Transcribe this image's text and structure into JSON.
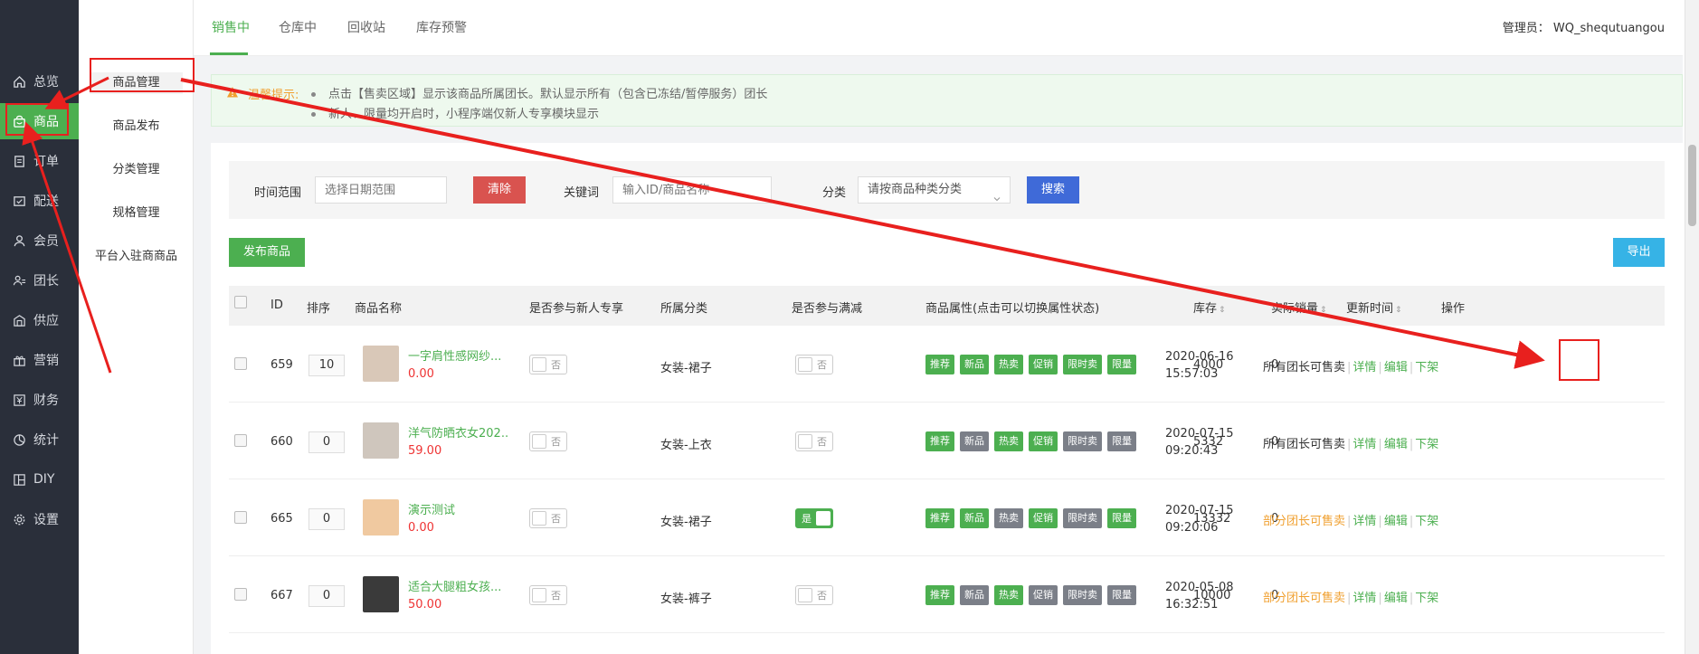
{
  "nav": {
    "items": [
      {
        "label": "总览",
        "icon": "home-icon"
      },
      {
        "label": "商品",
        "icon": "shop-bag-icon",
        "active": true
      },
      {
        "label": "订单",
        "icon": "order-icon"
      },
      {
        "label": "配送",
        "icon": "delivery-icon"
      },
      {
        "label": "会员",
        "icon": "user-icon"
      },
      {
        "label": "团长",
        "icon": "leader-icon"
      },
      {
        "label": "供应",
        "icon": "supply-icon"
      },
      {
        "label": "营销",
        "icon": "gift-icon"
      },
      {
        "label": "财务",
        "icon": "finance-icon"
      },
      {
        "label": "统计",
        "icon": "chart-icon"
      },
      {
        "label": "DIY",
        "icon": "diy-icon"
      },
      {
        "label": "设置",
        "icon": "settings-icon"
      }
    ]
  },
  "submenu": {
    "items": [
      "商品管理",
      "商品发布",
      "分类管理",
      "规格管理",
      "平台入驻商商品"
    ]
  },
  "tabs": [
    "销售中",
    "仓库中",
    "回收站",
    "库存预警"
  ],
  "admin": "管理员： WQ_shequtuangou",
  "tip": {
    "label": "温馨提示:",
    "lines": [
      "点击【售卖区域】显示该商品所属团长。默认显示所有（包含已冻结/暂停服务）团长",
      "新人、限量均开启时，小程序端仅新人专享模块显示"
    ]
  },
  "filter": {
    "time_label": "时间范围",
    "time_placeholder": "选择日期范围",
    "clear_label": "清除",
    "keyword_label": "关键词",
    "keyword_placeholder": "输入ID/商品名称",
    "category_label": "分类",
    "category_placeholder": "请按商品种类分类",
    "search_label": "搜索"
  },
  "actions": {
    "publish_label": "发布商品",
    "export_label": "导出"
  },
  "table": {
    "headers": {
      "id": "ID",
      "sort": "排序",
      "name": "商品名称",
      "newcomer": "是否参与新人专享",
      "category": "所属分类",
      "fullcut": "是否参与满减",
      "attrs": "商品属性(点击可以切换属性状态)",
      "stock": "库存",
      "sales": "实际销量",
      "updated": "更新时间",
      "ops": "操作"
    },
    "sort_marker": "⇕",
    "tag_names": [
      "推荐",
      "新品",
      "热卖",
      "促销",
      "限时卖",
      "限量"
    ],
    "rows": [
      {
        "id": "659",
        "sort": "10",
        "name": "一字肩性感网纱...",
        "price": "0.00",
        "thumb_color": "#d9c8b8",
        "newcomer": "否",
        "category": "女装-裙子",
        "fullcut": "否",
        "fullcut_on": false,
        "tags_on": [
          true,
          true,
          true,
          true,
          true,
          true
        ],
        "stock": "4000",
        "sales": "0",
        "date": "2020-06-16",
        "time": "15:57:03",
        "scope": "所有团长可售卖",
        "scope_partial": false,
        "op_detail": "详情",
        "op_edit": "编辑",
        "op_off": "下架"
      },
      {
        "id": "660",
        "sort": "0",
        "name": "洋气防晒衣女202...",
        "price": "59.00",
        "thumb_color": "#cfc6bd",
        "newcomer": "否",
        "category": "女装-上衣",
        "fullcut": "否",
        "fullcut_on": false,
        "tags_on": [
          true,
          false,
          true,
          true,
          false,
          false
        ],
        "stock": "5332",
        "sales": "0",
        "date": "2020-07-15",
        "time": "09:20:43",
        "scope": "所有团长可售卖",
        "scope_partial": false,
        "op_detail": "详情",
        "op_edit": "编辑",
        "op_off": "下架"
      },
      {
        "id": "665",
        "sort": "0",
        "name": "演示测试",
        "price": "0.00",
        "thumb_color": "#f0c9a0",
        "newcomer": "否",
        "category": "女装-裙子",
        "fullcut": "是",
        "fullcut_on": true,
        "tags_on": [
          true,
          true,
          false,
          true,
          false,
          true
        ],
        "stock": "13332",
        "sales": "0",
        "date": "2020-07-15",
        "time": "09:20:06",
        "scope": "部分团长可售卖",
        "scope_partial": true,
        "op_detail": "详情",
        "op_edit": "编辑",
        "op_off": "下架"
      },
      {
        "id": "667",
        "sort": "0",
        "name": "适合大腿粗女孩...",
        "price": "50.00",
        "thumb_color": "#3a3a3a",
        "newcomer": "否",
        "category": "女装-裤子",
        "fullcut": "否",
        "fullcut_on": false,
        "tags_on": [
          true,
          false,
          true,
          false,
          false,
          false
        ],
        "stock": "10000",
        "sales": "0",
        "date": "2020-05-08",
        "time": "16:32:51",
        "scope": "部分团长可售卖",
        "scope_partial": true,
        "op_detail": "详情",
        "op_edit": "编辑",
        "op_off": "下架"
      }
    ]
  },
  "colors": {
    "brand": "#4caf50",
    "sidebar": "#2a2f3a",
    "danger": "#d9534f",
    "primary": "#3f6ad8",
    "info": "#36b3e6",
    "annotation": "#e8201e"
  }
}
